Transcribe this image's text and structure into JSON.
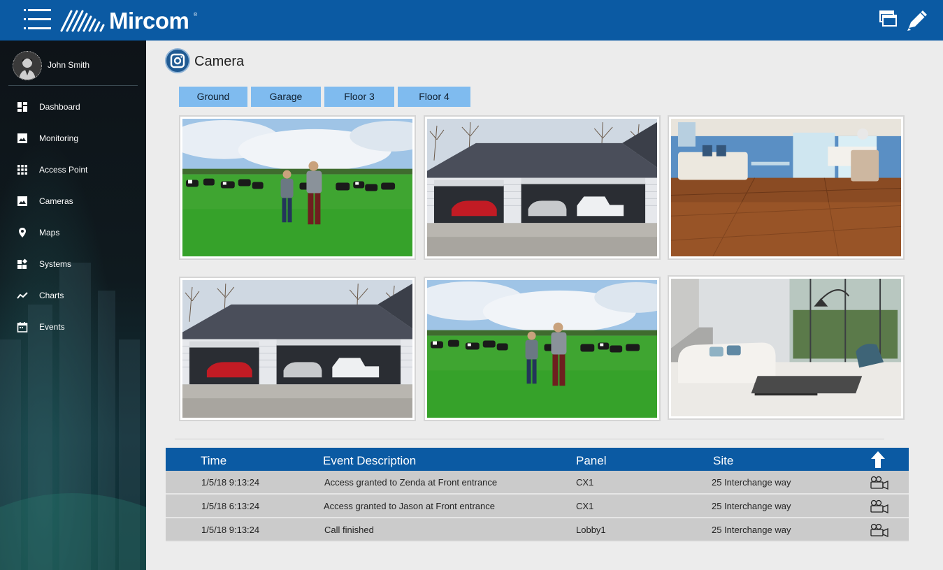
{
  "app": {
    "brand": "Mircom",
    "trademark": "®",
    "accent_color": "#0b5aa3",
    "icons": [
      "menu-icon",
      "windows-icon",
      "edit-icon"
    ]
  },
  "user": {
    "name": "John Smith"
  },
  "sidebar": {
    "items": [
      {
        "label": "Dashboard",
        "icon": "dashboard-icon"
      },
      {
        "label": "Monitoring",
        "icon": "image-icon"
      },
      {
        "label": "Access Point",
        "icon": "grid-icon"
      },
      {
        "label": "Cameras",
        "icon": "image-icon"
      },
      {
        "label": "Maps",
        "icon": "map-pin-icon"
      },
      {
        "label": "Systems",
        "icon": "widgets-icon"
      },
      {
        "label": "Charts",
        "icon": "trend-icon"
      },
      {
        "label": "Events",
        "icon": "calendar-icon"
      }
    ]
  },
  "page": {
    "title": "Camera"
  },
  "floors": [
    "Ground",
    "Garage",
    "Floor 3",
    "Floor 4"
  ],
  "cameras": [
    {
      "scene": "field-cows"
    },
    {
      "scene": "garage"
    },
    {
      "scene": "living-room-wood"
    },
    {
      "scene": "garage"
    },
    {
      "scene": "field-cows"
    },
    {
      "scene": "living-room-white"
    }
  ],
  "events": {
    "columns": [
      "Time",
      "Event Description",
      "Panel",
      "Site"
    ],
    "rows": [
      {
        "time": "1/5/18  9:13:24",
        "description": "Access granted to Zenda at Front entrance",
        "panel": "CX1",
        "site": "25 Interchange way"
      },
      {
        "time": "1/5/18  6:13:24",
        "description": "Access granted to Jason at Front entrance",
        "panel": "CX1",
        "site": "25 Interchange way"
      },
      {
        "time": "1/5/18  9:13:24",
        "description": "Call finished",
        "panel": "Lobby1",
        "site": "25 Interchange way"
      }
    ]
  }
}
